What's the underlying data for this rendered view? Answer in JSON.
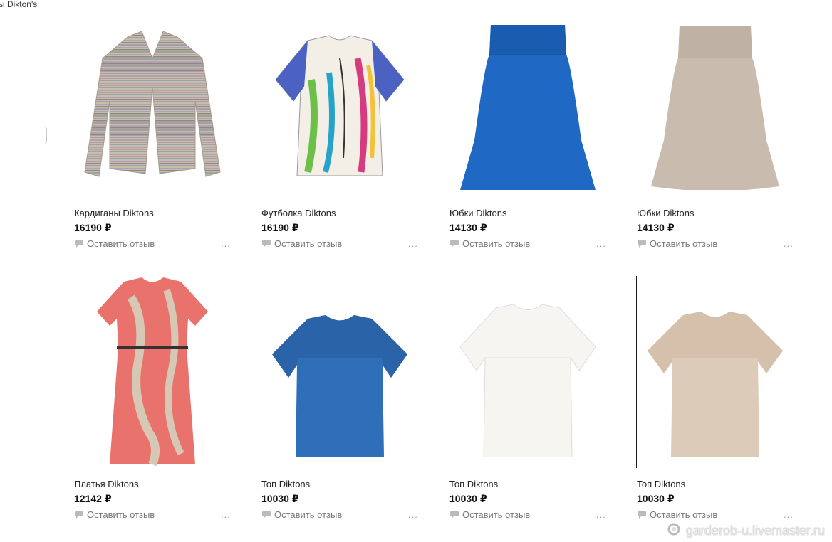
{
  "header": {
    "partial_title": "ы Dikton's"
  },
  "products": [
    {
      "title": "Кардиганы Diktons",
      "price": "16190 ₽",
      "review_label": "Оставить отзыв",
      "more_label": "...",
      "image_icon": "striped-cardigan-icon"
    },
    {
      "title": "Футболка Diktons",
      "price": "16190 ₽",
      "review_label": "Оставить отзыв",
      "more_label": "...",
      "image_icon": "printed-tshirt-icon"
    },
    {
      "title": "Юбки Diktons",
      "price": "14130 ₽",
      "review_label": "Оставить отзыв",
      "more_label": "...",
      "image_icon": "blue-skirt-icon"
    },
    {
      "title": "Юбки Diktons",
      "price": "14130 ₽",
      "review_label": "Оставить отзыв",
      "more_label": "...",
      "image_icon": "beige-skirt-icon"
    },
    {
      "title": "Платья Diktons",
      "price": "12142 ₽",
      "review_label": "Оставить отзыв",
      "more_label": "...",
      "image_icon": "coral-dress-icon"
    },
    {
      "title": "Топ Diktons",
      "price": "10030 ₽",
      "review_label": "Оставить отзыв",
      "more_label": "...",
      "image_icon": "blue-top-icon"
    },
    {
      "title": "Топ Diktons",
      "price": "10030 ₽",
      "review_label": "Оставить отзыв",
      "more_label": "...",
      "image_icon": "white-top-icon"
    },
    {
      "title": "Топ Diktons",
      "price": "10030 ₽",
      "review_label": "Оставить отзыв",
      "more_label": "...",
      "image_icon": "beige-top-icon"
    }
  ],
  "watermark": {
    "text": "garderob-u.livemaster.ru"
  },
  "colors": {
    "cardigan": "#b9ab9c",
    "tshirt_sleeve": "#4b62c2",
    "skirt_blue": "#1f69c5",
    "skirt_beige": "#c9bbae",
    "dress": "#e9736c",
    "top_blue": "#2f6eb8",
    "top_white": "#f7f5f1",
    "top_beige": "#dccbb9"
  }
}
